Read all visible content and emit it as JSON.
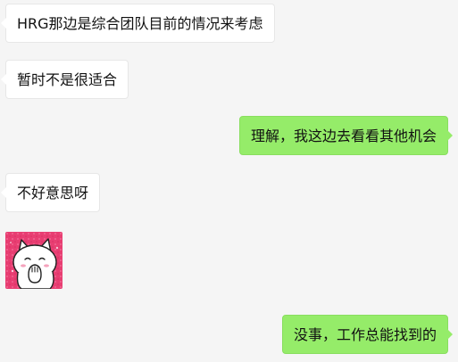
{
  "messages": [
    {
      "id": "m1",
      "side": "incoming",
      "type": "text",
      "text": "HRG那边是综合团队目前的情况来考虑"
    },
    {
      "id": "m2",
      "side": "incoming",
      "type": "text",
      "text": "暂时不是很适合"
    },
    {
      "id": "m3",
      "side": "outgoing",
      "type": "text",
      "text": "理解，我这边去看看其他机会"
    },
    {
      "id": "m4",
      "side": "incoming",
      "type": "text",
      "text": "不好意思呀"
    },
    {
      "id": "m5",
      "side": "incoming",
      "type": "sticker",
      "sticker": "cat-covering-mouth-sticker"
    },
    {
      "id": "m6",
      "side": "outgoing",
      "type": "text",
      "text": "没事，工作总能找到的"
    }
  ],
  "colors": {
    "background": "#f5f5f5",
    "incoming_bubble": "#ffffff",
    "outgoing_bubble": "#95ec69",
    "sticker_background": "#e83e72"
  }
}
